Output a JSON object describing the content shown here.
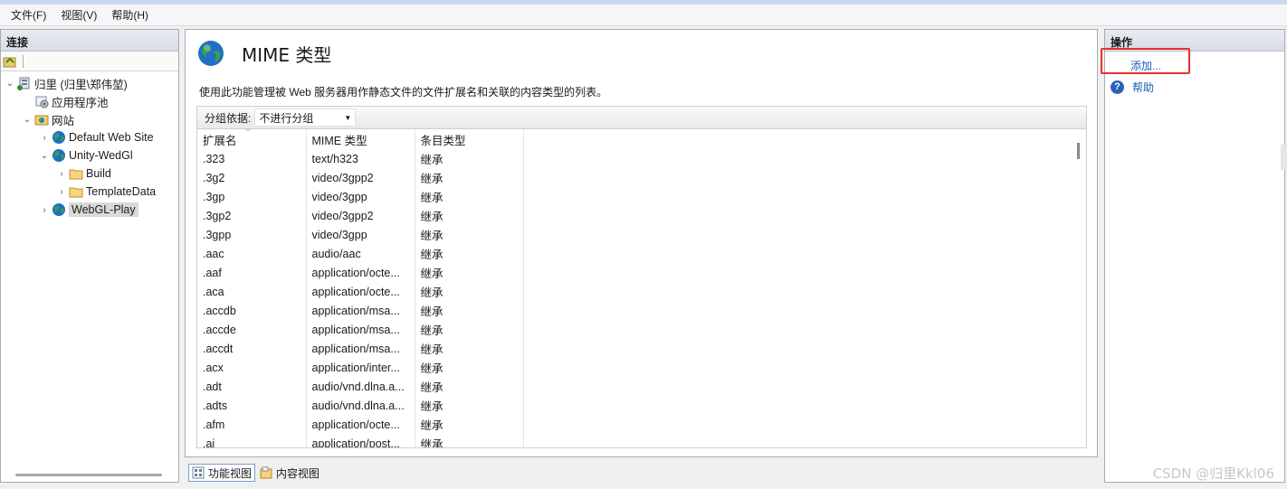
{
  "menu": [
    "文件(F)",
    "视图(V)",
    "帮助(H)"
  ],
  "connections": {
    "header": "连接",
    "tree": [
      {
        "label": "归里 (归里\\郑伟堃)",
        "icon": "server-icon",
        "level": 0,
        "expander": "expanded"
      },
      {
        "label": "应用程序池",
        "icon": "app-pool-icon",
        "level": 1,
        "expander": "none"
      },
      {
        "label": "网站",
        "icon": "sites-folder-icon",
        "level": 1,
        "expander": "expanded"
      },
      {
        "label": "Default Web Site",
        "icon": "globe-icon",
        "level": 2,
        "expander": "collapsed"
      },
      {
        "label": "Unity-WedGl",
        "icon": "globe-icon",
        "level": 2,
        "expander": "expanded"
      },
      {
        "label": "Build",
        "icon": "folder-icon",
        "level": 3,
        "expander": "collapsed"
      },
      {
        "label": "TemplateData",
        "icon": "folder-icon",
        "level": 3,
        "expander": "collapsed"
      },
      {
        "label": "WebGL-Play",
        "icon": "globe-icon",
        "level": 2,
        "expander": "collapsed",
        "selected": true
      }
    ]
  },
  "main": {
    "title": "MIME 类型",
    "description": "使用此功能管理被 Web 服务器用作静态文件的文件扩展名和关联的内容类型的列表。",
    "group_label": "分组依据:",
    "group_value": "不进行分组",
    "columns": [
      "扩展名",
      "MIME 类型",
      "条目类型"
    ],
    "rows": [
      [
        ".323",
        "text/h323",
        "继承"
      ],
      [
        ".3g2",
        "video/3gpp2",
        "继承"
      ],
      [
        ".3gp",
        "video/3gpp",
        "继承"
      ],
      [
        ".3gp2",
        "video/3gpp2",
        "继承"
      ],
      [
        ".3gpp",
        "video/3gpp",
        "继承"
      ],
      [
        ".aac",
        "audio/aac",
        "继承"
      ],
      [
        ".aaf",
        "application/octe...",
        "继承"
      ],
      [
        ".aca",
        "application/octe...",
        "继承"
      ],
      [
        ".accdb",
        "application/msa...",
        "继承"
      ],
      [
        ".accde",
        "application/msa...",
        "继承"
      ],
      [
        ".accdt",
        "application/msa...",
        "继承"
      ],
      [
        ".acx",
        "application/inter...",
        "继承"
      ],
      [
        ".adt",
        "audio/vnd.dlna.a...",
        "继承"
      ],
      [
        ".adts",
        "audio/vnd.dlna.a...",
        "继承"
      ],
      [
        ".afm",
        "application/octe...",
        "继承"
      ],
      [
        ".ai",
        "application/post...",
        "继承"
      ]
    ]
  },
  "bottom_tabs": [
    "功能视图",
    "内容视图"
  ],
  "actions": {
    "header": "操作",
    "add": "添加...",
    "help": "帮助"
  },
  "watermark": "CSDN @归里Kkl06",
  "colors": {
    "link": "#1b5fb5",
    "highlight": "#e8302e",
    "selected_bg": "#d9d9d9"
  }
}
